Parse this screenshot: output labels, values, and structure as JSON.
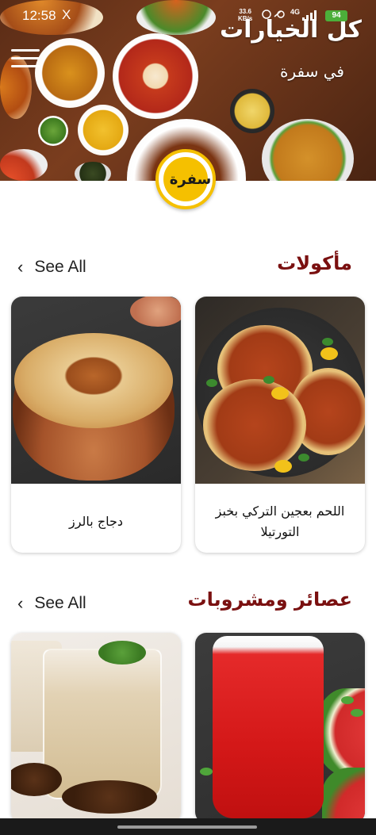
{
  "status_bar": {
    "time": "12:58",
    "x_icon": "X",
    "speed_value": "33.6",
    "speed_unit": "KB/s",
    "network": "4G",
    "battery": "94"
  },
  "banner": {
    "title": "كل الخيارات",
    "subtitle": "في سفرة"
  },
  "logo": {
    "text": "سفرة",
    "color": "#f5c000"
  },
  "sections": [
    {
      "title": "مأكولات",
      "see_all": "See All",
      "cards": [
        {
          "label": "اللحم بعجين التركي بخبز التورتيلا",
          "image": "lahm-bajeen-photo"
        },
        {
          "label": "دجاج بالرز",
          "image": "chicken-rice-photo"
        }
      ]
    },
    {
      "title": "عصائر ومشروبات",
      "see_all": "See All",
      "cards": [
        {
          "label": "",
          "image": "watermelon-juice-photo"
        },
        {
          "label": "",
          "image": "date-milkshake-photo"
        }
      ]
    }
  ],
  "colors": {
    "section_title": "#7a1010",
    "battery": "#4caf3a",
    "logo_ring": "#f5c000"
  },
  "icons": [
    "menu-icon",
    "chevron-left-icon",
    "signal-icon",
    "battery-icon"
  ]
}
